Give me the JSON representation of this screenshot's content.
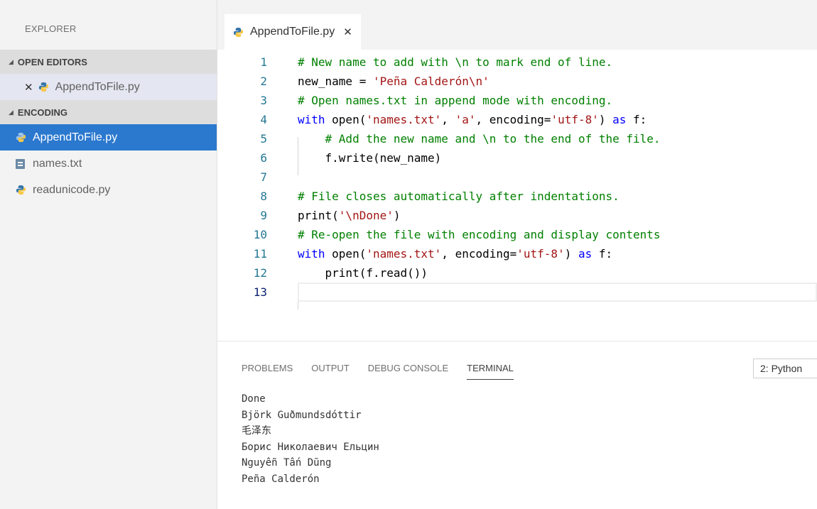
{
  "sidebar": {
    "title": "EXPLORER",
    "open_editors_header": "OPEN EDITORS",
    "open_editors": [
      {
        "name": "AppendToFile.py",
        "icon": "python-file-icon"
      }
    ],
    "folder_header": "ENCODING",
    "files": [
      {
        "name": "AppendToFile.py",
        "icon": "python-file-icon",
        "selected": true
      },
      {
        "name": "names.txt",
        "icon": "text-file-icon",
        "selected": false
      },
      {
        "name": "readunicode.py",
        "icon": "python-file-icon",
        "selected": false
      }
    ]
  },
  "editor": {
    "active_tab": "AppendToFile.py",
    "lines": [
      {
        "num": "1",
        "tokens": [
          {
            "t": "comment",
            "v": "# New name to add with \\n to mark end of line."
          }
        ]
      },
      {
        "num": "2",
        "tokens": [
          {
            "t": "text",
            "v": "new_name = "
          },
          {
            "t": "string",
            "v": "'Peña Calderón\\n'"
          }
        ]
      },
      {
        "num": "3",
        "tokens": [
          {
            "t": "comment",
            "v": "# Open names.txt in append mode with encoding."
          }
        ]
      },
      {
        "num": "4",
        "tokens": [
          {
            "t": "kw",
            "v": "with"
          },
          {
            "t": "text",
            "v": " open("
          },
          {
            "t": "string",
            "v": "'names.txt'"
          },
          {
            "t": "text",
            "v": ", "
          },
          {
            "t": "string",
            "v": "'a'"
          },
          {
            "t": "text",
            "v": ", encoding="
          },
          {
            "t": "string",
            "v": "'utf-8'"
          },
          {
            "t": "text",
            "v": ") "
          },
          {
            "t": "kw",
            "v": "as"
          },
          {
            "t": "text",
            "v": " f:"
          }
        ]
      },
      {
        "num": "5",
        "tokens": [
          {
            "t": "text",
            "v": "    "
          },
          {
            "t": "comment",
            "v": "# Add the new name and \\n to the end of the file."
          }
        ]
      },
      {
        "num": "6",
        "tokens": [
          {
            "t": "text",
            "v": "    f.write(new_name)"
          }
        ]
      },
      {
        "num": "7",
        "tokens": []
      },
      {
        "num": "8",
        "tokens": [
          {
            "t": "comment",
            "v": "# File closes automatically after indentations."
          }
        ]
      },
      {
        "num": "9",
        "tokens": [
          {
            "t": "text",
            "v": "print("
          },
          {
            "t": "string",
            "v": "'\\nDone'"
          },
          {
            "t": "text",
            "v": ")"
          }
        ]
      },
      {
        "num": "10",
        "tokens": [
          {
            "t": "comment",
            "v": "# Re-open the file with encoding and display contents"
          }
        ]
      },
      {
        "num": "11",
        "tokens": [
          {
            "t": "kw",
            "v": "with"
          },
          {
            "t": "text",
            "v": " open("
          },
          {
            "t": "string",
            "v": "'names.txt'"
          },
          {
            "t": "text",
            "v": ", encoding="
          },
          {
            "t": "string",
            "v": "'utf-8'"
          },
          {
            "t": "text",
            "v": ") "
          },
          {
            "t": "kw",
            "v": "as"
          },
          {
            "t": "text",
            "v": " f:"
          }
        ]
      },
      {
        "num": "12",
        "tokens": [
          {
            "t": "text",
            "v": "    print(f.read())"
          }
        ]
      },
      {
        "num": "13",
        "tokens": []
      }
    ],
    "current_line": "13"
  },
  "panel": {
    "tabs": [
      "PROBLEMS",
      "OUTPUT",
      "DEBUG CONSOLE",
      "TERMINAL"
    ],
    "active_tab": "TERMINAL",
    "terminal_select": "2: Python",
    "terminal_lines": [
      "Done",
      "Björk Guðmundsdóttir",
      "毛泽东",
      "Борис Николаевич Ельцин",
      "Nguyễn Tấn Dũng",
      "Peña Calderón"
    ]
  },
  "colors": {
    "selection": "#2b78cf",
    "comment": "#008000",
    "string": "#a31515",
    "keyword": "#0000ff",
    "line_number": "#237893"
  }
}
